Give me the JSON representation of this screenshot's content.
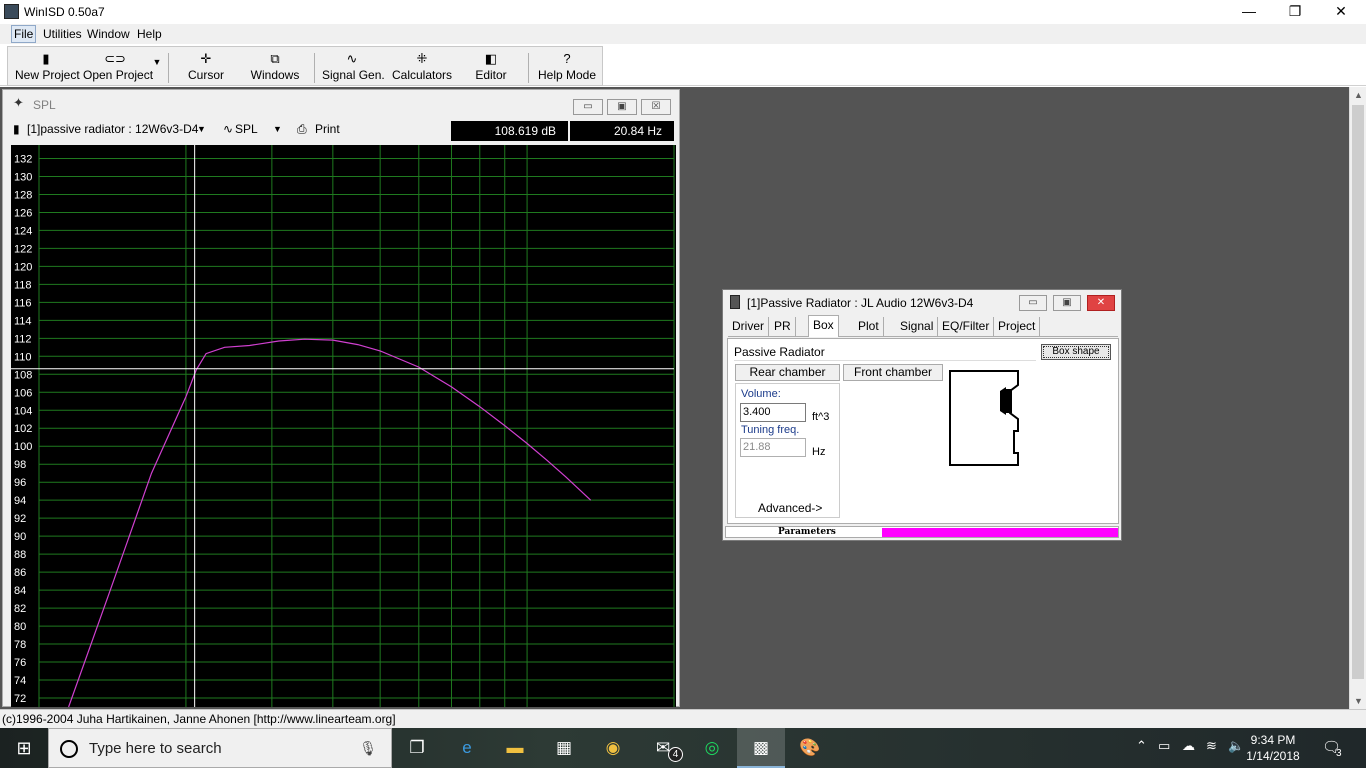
{
  "window": {
    "title": "WinISD 0.50a7",
    "minimize": "—",
    "restore": "❐",
    "close": "✕"
  },
  "menu": [
    "File",
    "Utilities",
    "Window",
    "Help"
  ],
  "toolbar": {
    "new_project": "New Project",
    "open_project": "Open Project",
    "cursor": "Cursor",
    "windows": "Windows",
    "signal_gen": "Signal Gen.",
    "calculators": "Calculators",
    "editor": "Editor",
    "help_mode": "Help Mode"
  },
  "spl": {
    "title": "SPL",
    "project_select": "[1]passive radiator : 12W6v3-D4",
    "graph_select": "SPL",
    "print": "Print",
    "readout_db": "108.619 dB",
    "readout_hz": "20.84 Hz"
  },
  "chart_data": {
    "type": "line",
    "title": "",
    "xlabel": "",
    "ylabel": "",
    "ylim": [
      71,
      133.5
    ],
    "y_ticks": [
      72,
      74,
      76,
      78,
      80,
      82,
      84,
      86,
      88,
      90,
      92,
      94,
      96,
      98,
      100,
      102,
      104,
      106,
      108,
      110,
      112,
      114,
      116,
      118,
      120,
      122,
      124,
      126,
      128,
      130,
      132
    ],
    "x_scale": "log",
    "xlim": [
      10,
      200
    ],
    "grid": true,
    "series": [
      {
        "color": "#d040d0",
        "x": [
          11.5,
          14,
          17,
          20,
          21,
          22,
          24,
          27,
          31,
          35,
          40,
          45,
          50,
          60,
          70,
          80,
          90,
          100,
          110,
          120,
          135
        ],
        "y": [
          71,
          84,
          97,
          105.5,
          108.5,
          110.3,
          111.0,
          111.2,
          111.7,
          111.9,
          111.8,
          111.3,
          110.6,
          108.8,
          106.6,
          104.4,
          102.3,
          100.3,
          98.4,
          96.6,
          94.0
        ]
      }
    ],
    "cursor": {
      "x": 20.84,
      "y": 108.619,
      "color": "#ffffff"
    }
  },
  "pr_dialog": {
    "title": "[1]Passive Radiator : JL Audio 12W6v3-D4",
    "tabs": [
      "Driver",
      "PR",
      "Box",
      "Plot",
      "Signal",
      "EQ/Filter",
      "Project"
    ],
    "selected_tab": "Box",
    "box_type": "Passive Radiator",
    "box_shape_button": "Box shape",
    "rear_chamber": "Rear chamber",
    "front_chamber": "Front chamber",
    "volume_label": "Volume:",
    "volume_value": "3.400",
    "volume_unit": "ft^3",
    "tuning_label": "Tuning freq.",
    "tuning_value": "21.88",
    "tuning_unit": "Hz",
    "advanced": "Advanced->",
    "status_label": "Parameters",
    "status_color": "#ff00ff"
  },
  "statusbar": "(c)1996-2004 Juha Hartikainen, Janne Ahonen [http://www.linearteam.org]",
  "taskbar": {
    "search_placeholder": "Type here to search",
    "mail_badge": "4",
    "time": "9:34 PM",
    "date": "1/14/2018",
    "notifications": "3"
  }
}
